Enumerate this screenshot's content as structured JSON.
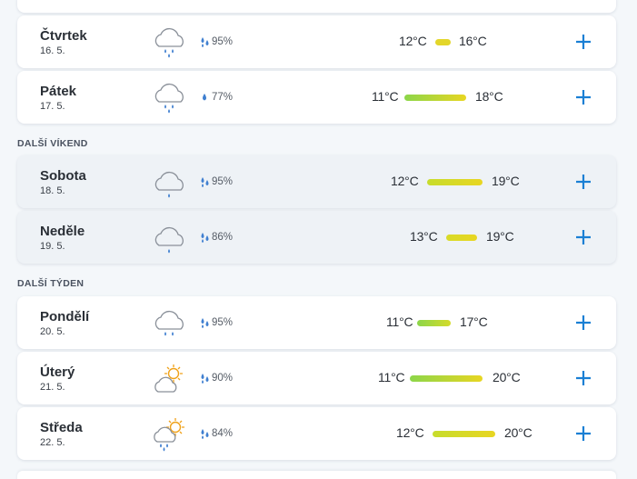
{
  "sections": {
    "weekend": "DALŠÍ VÍKEND",
    "next_week": "DALŠÍ TÝDEN"
  },
  "days": [
    {
      "day": "Čtvrtek",
      "date": "16. 5.",
      "icon": "heavy-rain-cloud-icon",
      "precip": "95%",
      "tmin": "12°C",
      "tmax": "16°C"
    },
    {
      "day": "Pátek",
      "date": "17. 5.",
      "icon": "heavy-rain-cloud-icon",
      "precip": "77%",
      "tmin": "11°C",
      "tmax": "18°C"
    },
    {
      "day": "Sobota",
      "date": "18. 5.",
      "icon": "light-rain-cloud-icon",
      "precip": "95%",
      "tmin": "12°C",
      "tmax": "19°C"
    },
    {
      "day": "Neděle",
      "date": "19. 5.",
      "icon": "light-rain-cloud-icon",
      "precip": "86%",
      "tmin": "13°C",
      "tmax": "19°C"
    },
    {
      "day": "Pondělí",
      "date": "20. 5.",
      "icon": "rain-cloud-icon",
      "precip": "95%",
      "tmin": "11°C",
      "tmax": "17°C"
    },
    {
      "day": "Úterý",
      "date": "21. 5.",
      "icon": "partly-sunny-icon",
      "precip": "90%",
      "tmin": "11°C",
      "tmax": "20°C"
    },
    {
      "day": "Středa",
      "date": "22. 5.",
      "icon": "sun-rain-cloud-icon",
      "precip": "84%",
      "tmin": "12°C",
      "tmax": "20°C"
    }
  ],
  "colors": {
    "accent": "#1a7fd4",
    "drop": "#3f7fd0",
    "bar_cool": "#8cd64a",
    "bar_warm": "#e8d622"
  }
}
